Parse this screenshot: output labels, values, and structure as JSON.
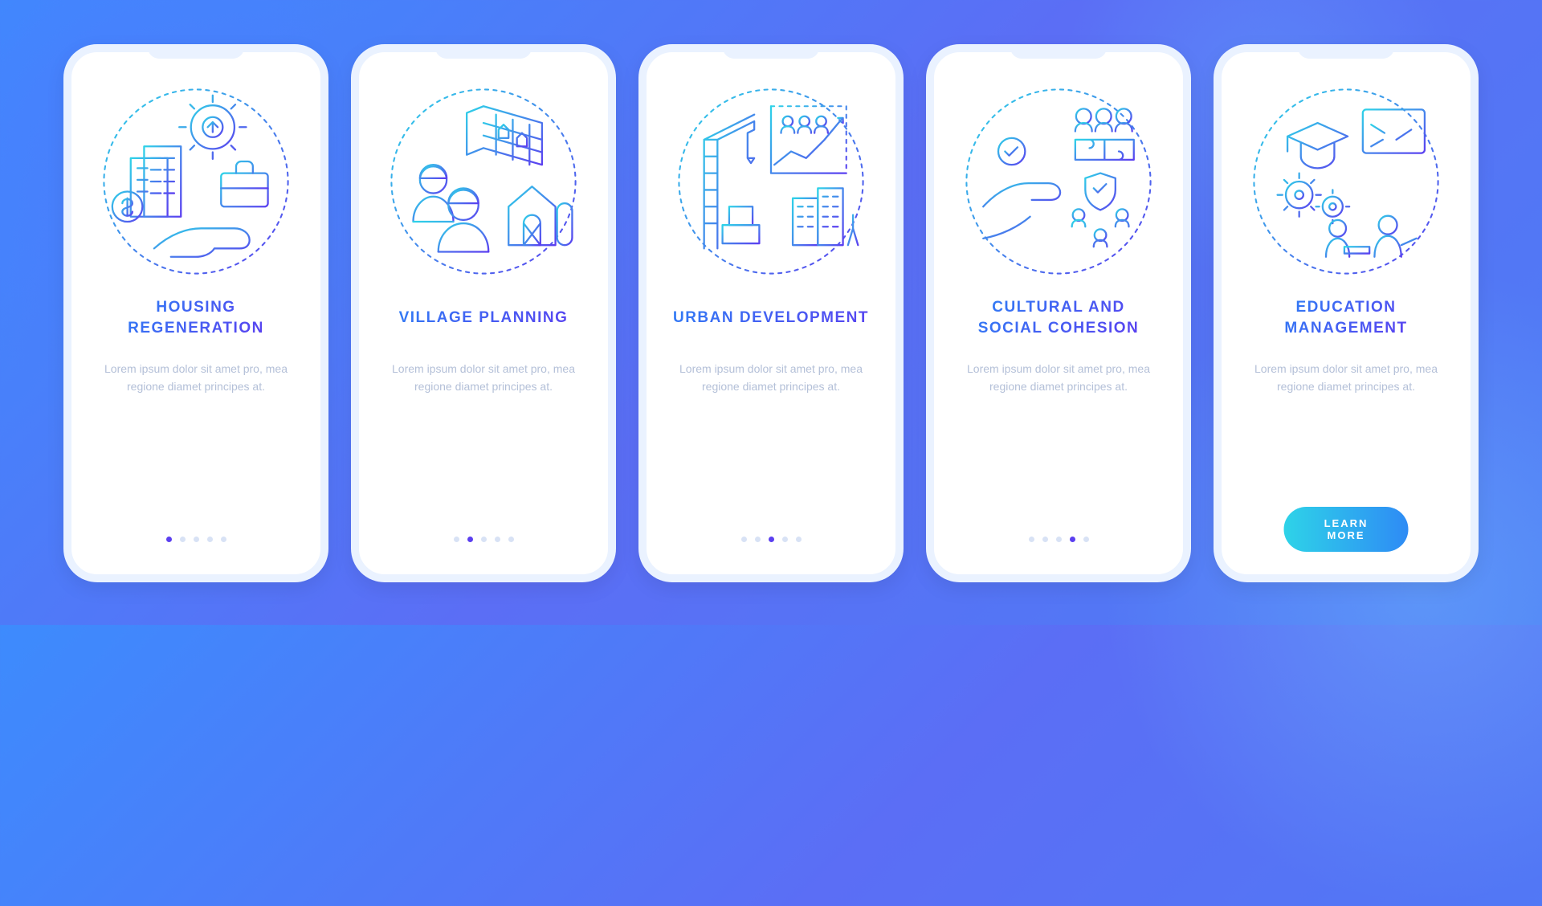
{
  "screens": [
    {
      "title": "HOUSING\nREGENERATION",
      "body": "Lorem ipsum dolor sit amet pro, mea regione diamet principes at.",
      "activeDot": 0,
      "icon": "housing-regeneration-icon"
    },
    {
      "title": "VILLAGE PLANNING",
      "body": "Lorem ipsum dolor sit amet pro, mea regione diamet principes at.",
      "activeDot": 1,
      "icon": "village-planning-icon"
    },
    {
      "title": "URBAN DEVELOPMENT",
      "body": "Lorem ipsum dolor sit amet pro, mea regione diamet principes at.",
      "activeDot": 2,
      "icon": "urban-development-icon"
    },
    {
      "title": "CULTURAL AND\nSOCIAL COHESION",
      "body": "Lorem ipsum dolor sit amet pro, mea regione diamet principes at.",
      "activeDot": 3,
      "icon": "cultural-social-cohesion-icon"
    },
    {
      "title": "EDUCATION\nMANAGEMENT",
      "body": "Lorem ipsum dolor sit amet pro, mea regione diamet principes at.",
      "activeDot": 4,
      "icon": "education-management-icon"
    }
  ],
  "dotsPerScreen": 5,
  "ctaLabel": "LEARN MORE",
  "colors": {
    "gradientStart": "#2ed3e8",
    "gradientEnd": "#5b3ff0",
    "dotInactive": "#d8e2f5",
    "dotActive": "#5b3ff0",
    "bodyText": "#b4c0d8"
  }
}
